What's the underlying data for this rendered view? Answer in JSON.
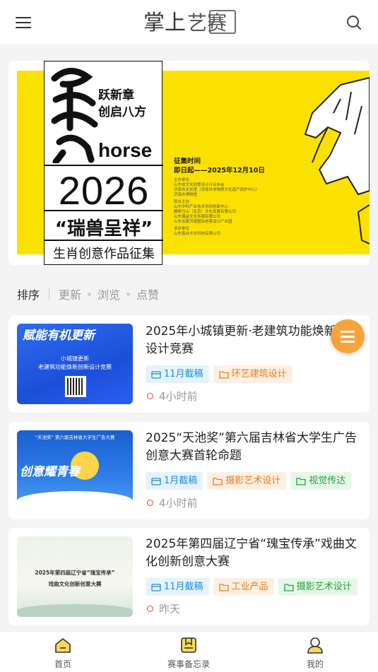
{
  "header": {
    "logo_text": "掌上艺赛",
    "menu_icon": "hamburger-menu-icon",
    "search_icon": "search-icon"
  },
  "banner": {
    "slogan_line1": "跃新章",
    "slogan_line2": "创启八方",
    "horse_word": "horse",
    "year": "2026",
    "ruishou": "“瑞兽呈祥”",
    "subtitle": "生肖创意作品征集",
    "deadline_label": "征集时间",
    "deadline_value": "即日起——2025年12月10日",
    "small_lines": [
      "主办单位",
      "山东省文化创意设计行业协会",
      "济南市文化馆（济南市非物质文化遗产保护中心）",
      "济南市博物馆",
      "联合主办",
      "山东中科产业技术协同创新中心",
      "麟凯行山（北京）文化发展有限公司",
      "山东偶益文化传媒有限公司",
      "山东出版济南国际创客设计产业园",
      "承办单位",
      "山东鑫台文化科技有限公司"
    ],
    "accent_color": "#fbe100"
  },
  "sort": {
    "active": "排序",
    "options": [
      "更新",
      "浏览",
      "点赞"
    ]
  },
  "cards": [
    {
      "title": "2025年小城镇更新·老建筑功能焕新创新设计竞赛",
      "thumb_text_top": "赋能有机更新",
      "thumb_text_mid1": "小城镇更新",
      "thumb_text_mid2": "老建筑功能焕新创新设计竞赛",
      "tags": [
        {
          "label": "11月截稿",
          "color": "blue",
          "icon": "calendar-icon"
        },
        {
          "label": "环艺建筑设计",
          "color": "orange",
          "icon": "folder-icon"
        }
      ],
      "time": "4小时前"
    },
    {
      "title": "2025“天池奖”第六届吉林省大学生广告创意大赛首轮命题",
      "thumb_text_top": "“天池奖” 第六届吉林省大学生广告大赛",
      "thumb_text_mid1": "创意耀青春",
      "tags": [
        {
          "label": "1月截稿",
          "color": "blue",
          "icon": "calendar-icon"
        },
        {
          "label": "摄影艺术设计",
          "color": "orange",
          "icon": "folder-icon"
        },
        {
          "label": "视觉传达",
          "color": "green",
          "icon": "folder-icon"
        }
      ],
      "time": "4小时前"
    },
    {
      "title": "2025年第四届辽宁省“瑰宝传承”戏曲文化创新创意大赛",
      "thumb_text_mid1": "2025年第四届辽宁省“瑰宝传承”",
      "thumb_text_mid2": "戏曲文化创新创意大赛",
      "tags": [
        {
          "label": "11月截稿",
          "color": "blue",
          "icon": "calendar-icon"
        },
        {
          "label": "工业产品",
          "color": "orange",
          "icon": "folder-icon"
        },
        {
          "label": "摄影艺术设计",
          "color": "green",
          "icon": "folder-icon"
        }
      ],
      "time": "昨天"
    }
  ],
  "bottom_nav": [
    {
      "label": "首页",
      "icon": "home-icon"
    },
    {
      "label": "赛事备忘录",
      "icon": "bookmark-memo-icon"
    },
    {
      "label": "我的",
      "icon": "user-icon"
    }
  ]
}
